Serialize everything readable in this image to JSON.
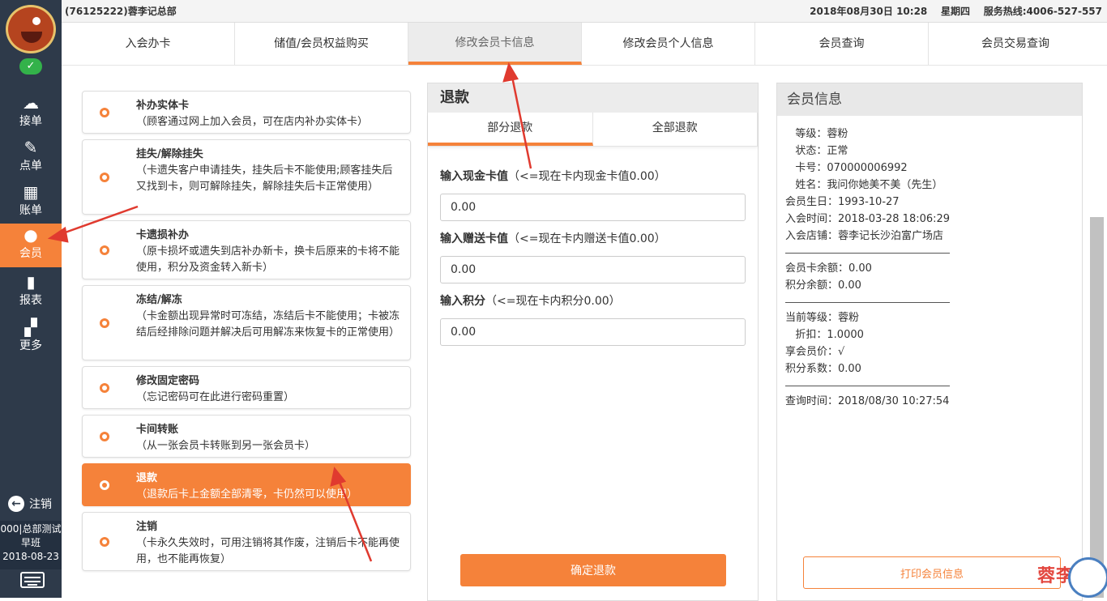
{
  "topbar": {
    "store": "(76125222)蓉李记总部",
    "datetime": "2018年08月30日 10:28",
    "weekday": "星期四",
    "hotline": "服务热线:4006-527-557"
  },
  "sidebar": {
    "items": [
      {
        "label": "接单",
        "icon": "cloud-download-icon"
      },
      {
        "label": "点单",
        "icon": "edit-icon"
      },
      {
        "label": "账单",
        "icon": "grid-icon"
      },
      {
        "label": "会员",
        "icon": "user-icon"
      },
      {
        "label": "报表",
        "icon": "bar-chart-icon"
      },
      {
        "label": "更多",
        "icon": "apps-icon"
      }
    ],
    "logout": "注销",
    "user_line1": "000|总部测试",
    "user_line2": "早班",
    "user_date": "2018-08-23"
  },
  "tabs": [
    "入会办卡",
    "储值/会员权益购买",
    "修改会员卡信息",
    "修改会员个人信息",
    "会员查询",
    "会员交易查询"
  ],
  "operations": [
    {
      "title": "补办实体卡",
      "desc": "（顾客通过网上加入会员，可在店内补办实体卡）"
    },
    {
      "title": "挂失/解除挂失",
      "desc": "（卡遗失客户申请挂失，挂失后卡不能使用;顾客挂失后又找到卡，则可解除挂失，解除挂失后卡正常使用）"
    },
    {
      "title": "卡遗损补办",
      "desc": "（原卡损坏或遗失到店补办新卡，换卡后原来的卡将不能使用，积分及资金转入新卡）"
    },
    {
      "title": "冻结/解冻",
      "desc": "（卡金额出现异常时可冻结，冻结后卡不能使用；卡被冻结后经排除问题并解决后可用解冻来恢复卡的正常使用）"
    },
    {
      "title": "修改固定密码",
      "desc": "（忘记密码可在此进行密码重置）"
    },
    {
      "title": "卡间转账",
      "desc": "（从一张会员卡转账到另一张会员卡）"
    },
    {
      "title": "退款",
      "desc": "（退款后卡上金额全部清零，卡仍然可以使用）"
    },
    {
      "title": "注销",
      "desc": "（卡永久失效时，可用注销将其作废，注销后卡不能再使用，也不能再恢复）"
    }
  ],
  "refund": {
    "title": "退款",
    "subtabs": [
      "部分退款",
      "全部退款"
    ],
    "cash_label": "输入现金卡值",
    "cash_hint": "（<=现在卡内现金卡值0.00）",
    "cash_value": "0.00",
    "gift_label": "输入赠送卡值",
    "gift_hint": "（<=现在卡内赠送卡值0.00）",
    "gift_value": "0.00",
    "points_label": "输入积分",
    "points_hint": "（<=现在卡内积分0.00）",
    "points_value": "0.00",
    "confirm": "确定退款"
  },
  "member": {
    "title": "会员信息",
    "level": "   等级：蓉粉",
    "status": "   状态：正常",
    "card": "   卡号：070000006992",
    "name": "   姓名：我问你她美不美（先生）",
    "birthday": "会员生日：1993-10-27",
    "join_time": "入会时间：2018-03-28 18:06:29",
    "join_store": "入会店铺：蓉李记长沙泊富广场店",
    "card_balance": "会员卡余额：0.00",
    "points_balance": "积分余额：0.00",
    "cur_level": "当前等级：蓉粉",
    "discount": "   折扣：1.0000",
    "member_price": "享会员价：√",
    "points_factor": "积分系数：0.00",
    "query_time": "查询时间：2018/08/30 10:27:54",
    "print": "打印会员信息"
  },
  "watermark": "蓉李记"
}
